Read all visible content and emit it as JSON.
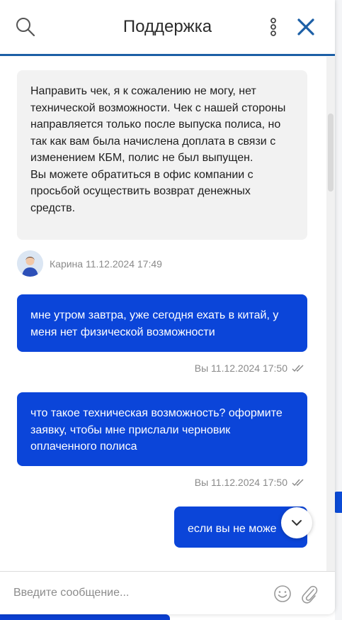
{
  "header": {
    "title": "Поддержка",
    "icons": [
      "search-icon",
      "more-vertical-icon",
      "close-icon"
    ]
  },
  "messages": {
    "operator_message": {
      "text": "Направить чек, я к сожалению не могу, нет технической возможности. Чек с нашей стороны направляется только после выпуска полиса, но так как вам была начислена доплата в связи с изменением КБМ, полис не был выпущен.\nВы можете обратиться в офис компании с просьбой осуществить возврат денежных средств.",
      "meta": "Карина 11.12.2024 17:49"
    },
    "user_messages": [
      {
        "text": "мне утром завтра, уже сегодня ехать в китай, у меня нет физической возможности",
        "meta": "Вы 11.12.2024 17:50"
      },
      {
        "text": "что такое техническая возможность? оформите заявку, чтобы мне прислали черновик оплаченного полиса",
        "meta": "Вы 11.12.2024 17:50"
      },
      {
        "text": "если вы не може"
      }
    ]
  },
  "input": {
    "placeholder": "Введите сообщение...",
    "value": ""
  },
  "colors": {
    "accent": "#0b45d9",
    "header_line": "#1c5fa6",
    "close_icon": "#1c5fa6",
    "operator_bubble": "#f2f2f2",
    "meta_text": "#8a8a8a"
  }
}
